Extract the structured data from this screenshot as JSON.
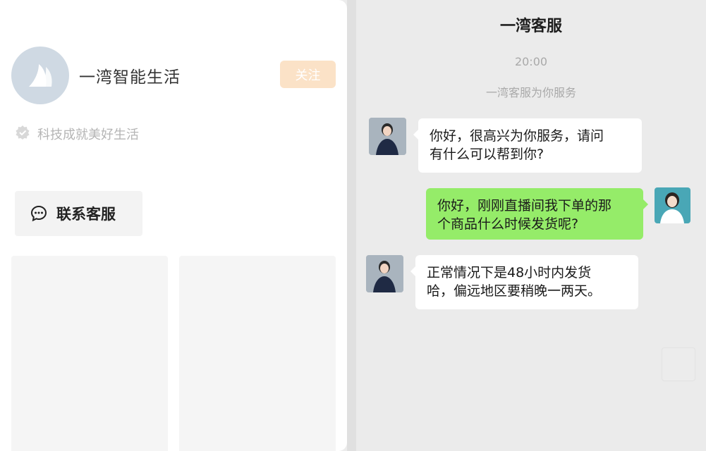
{
  "profile": {
    "brand_name": "一湾智能生活",
    "follow_label": "关注",
    "slogan": "科技成就美好生活",
    "contact_label": "联系客服",
    "logo_icon": "wave-logo-icon",
    "verified_icon": "verified-badge-icon",
    "contact_icon": "chat-bubble-icon"
  },
  "chat": {
    "title": "一湾客服",
    "time": "20:00",
    "system_message": "一湾客服为你服务",
    "messages": [
      {
        "side": "in",
        "text": "你好，很高兴为你服务，请问\n有什么可以帮到你?"
      },
      {
        "side": "out",
        "text": "你好，刚刚直播间我下单的那\n个商品什么时候发货呢?"
      },
      {
        "side": "in",
        "text": "正常情况下是48小时内发货\n哈，偏远地区要稍晚一两天。"
      }
    ]
  },
  "colors": {
    "accent_follow": "#fbe2c7",
    "bubble_out": "#95ec69",
    "bubble_in": "#ffffff"
  }
}
